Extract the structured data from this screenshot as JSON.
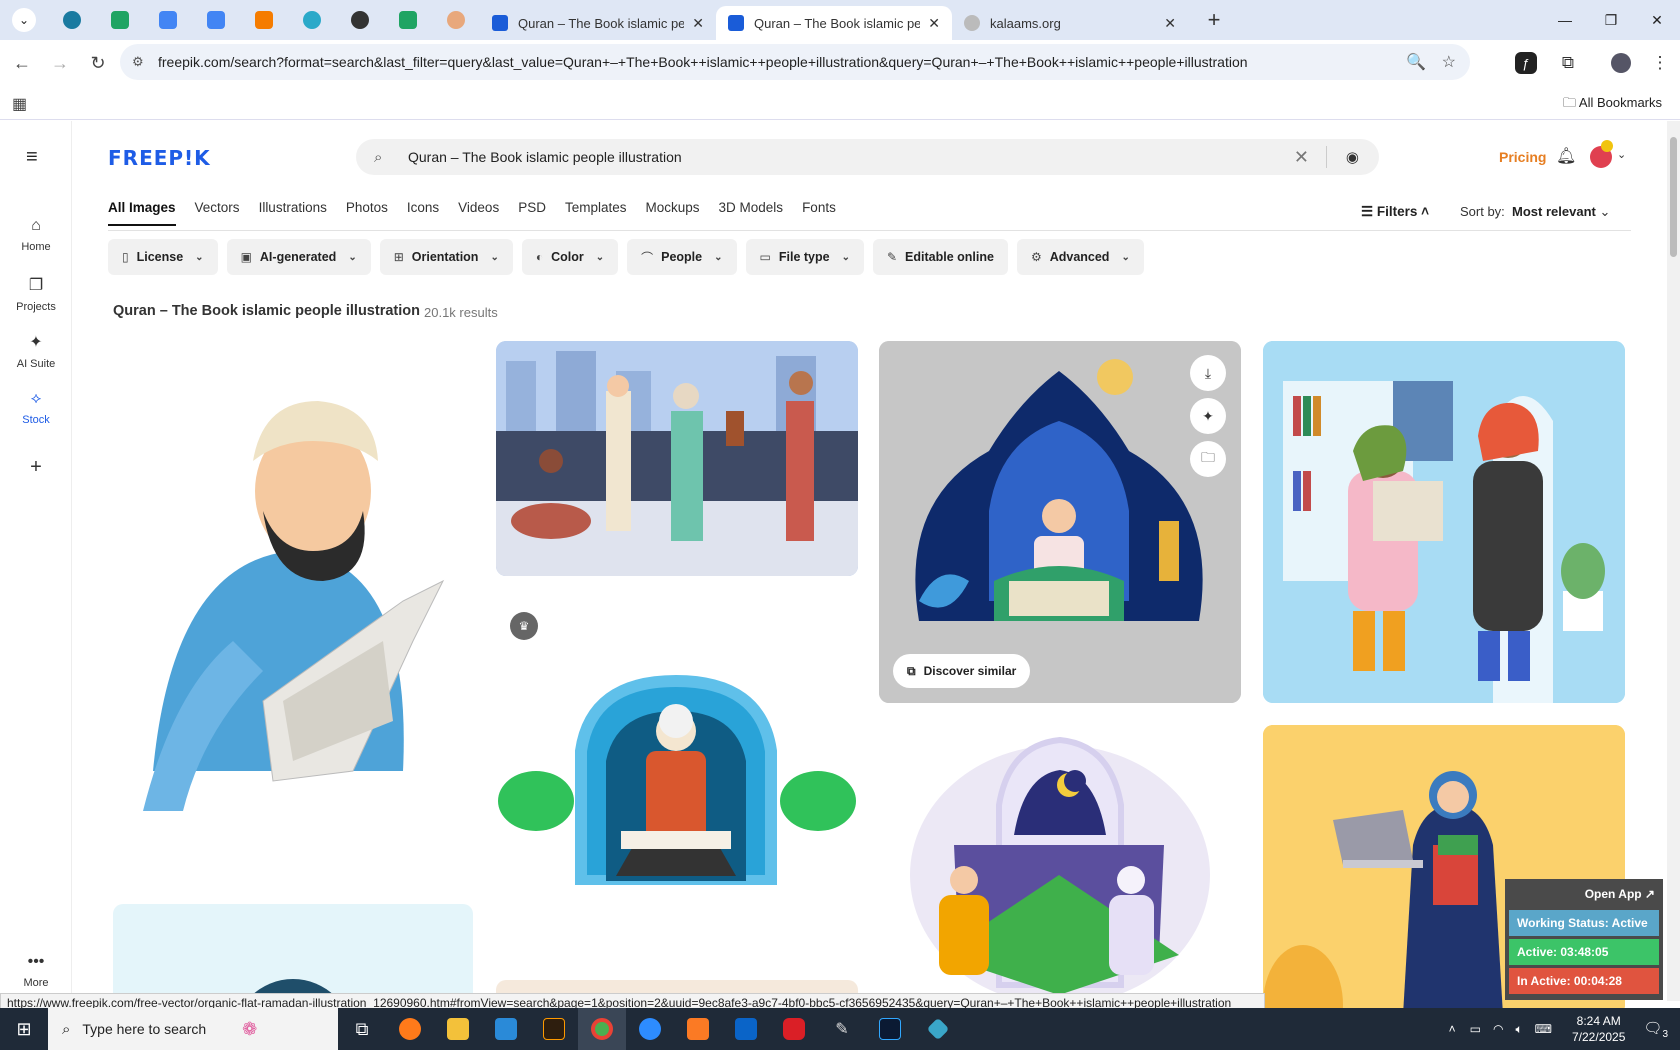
{
  "browser": {
    "tabs": [
      {
        "title": "Quran – The Book islamic peop",
        "active": false
      },
      {
        "title": "Quran – The Book islamic peop",
        "active": true
      },
      {
        "title": "kalaams.org",
        "active": false
      }
    ],
    "url": "freepik.com/search?format=search&last_filter=query&last_value=Quran+–+The+Book++islamic++people+illustration&query=Quran+–+The+Book++islamic++people+illustration",
    "all_bookmarks": "All Bookmarks"
  },
  "sidebar": {
    "items": [
      {
        "label": "Home"
      },
      {
        "label": "Projects"
      },
      {
        "label": "AI Suite"
      },
      {
        "label": "Stock"
      }
    ],
    "more_label": "More"
  },
  "header": {
    "logo": "FREEP!K",
    "search_value": "Quran – The Book  islamic  people illustration",
    "pricing": "Pricing"
  },
  "type_tabs": [
    "All Images",
    "Vectors",
    "Illustrations",
    "Photos",
    "Icons",
    "Videos",
    "PSD",
    "Templates",
    "Mockups",
    "3D Models",
    "Fonts"
  ],
  "filters_label": "Filters",
  "sort": {
    "label": "Sort by:",
    "value": "Most relevant"
  },
  "chips": [
    "License",
    "AI-generated",
    "Orientation",
    "Color",
    "People",
    "File type",
    "Editable online",
    "Advanced"
  ],
  "results": {
    "title": "Quran – The Book islamic people illustration",
    "count": "20.1k results"
  },
  "discover_similar": "Discover similar",
  "status_url": "https://www.freepik.com/free-vector/organic-flat-ramadan-illustration_12690960.htm#fromView=search&page=1&position=2&uuid=9ec8afe3-a9c7-4bf0-bbc5-cf3656952435&query=Quran+–+The+Book++islamic++people+illustration",
  "work_panel": {
    "open_app": "Open App ↗",
    "working_status": "Working Status: Active",
    "active": "Active: 03:48:05",
    "inactive": "In Active: 00:04:28"
  },
  "taskbar": {
    "search_placeholder": "Type here to search",
    "time": "8:24 AM",
    "date": "7/22/2025",
    "notifications": "3"
  },
  "colors": {
    "brand": "#1e5ce6",
    "pricing": "#e67e22",
    "active_green": "#2ecc71",
    "inactive_red": "#e74c3c"
  }
}
